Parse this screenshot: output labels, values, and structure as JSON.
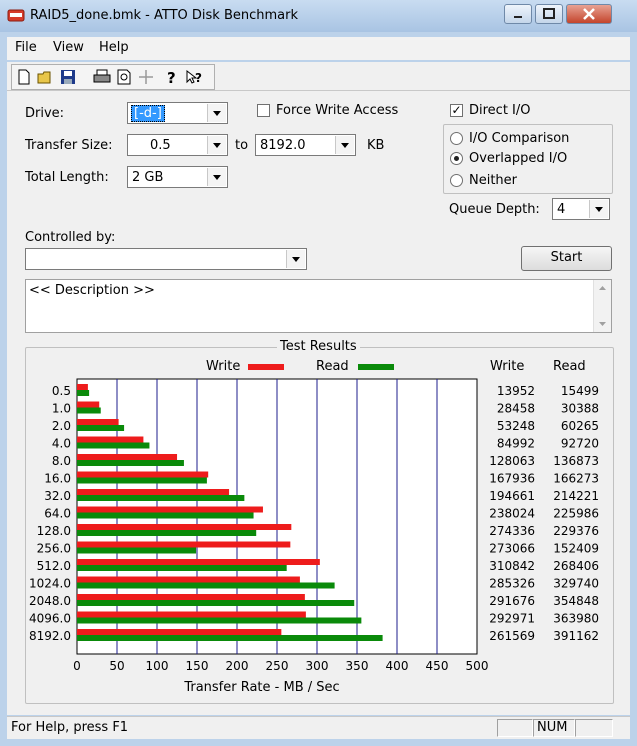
{
  "window": {
    "title": "RAID5_done.bmk - ATTO Disk Benchmark"
  },
  "menu": {
    "file": "File",
    "view": "View",
    "help": "Help"
  },
  "toolbar": {
    "icons": [
      "new-icon",
      "open-icon",
      "save-icon",
      "print-icon",
      "print-preview-icon",
      "move-icon",
      "help-icon",
      "context-help-icon"
    ]
  },
  "form": {
    "drive_label": "Drive:",
    "drive_value": "[-d-]",
    "force_write_label": "Force Write Access",
    "force_write_checked": false,
    "direct_io_label": "Direct I/O",
    "direct_io_checked": true,
    "transfer_size_label": "Transfer Size:",
    "transfer_from": "0.5",
    "to_label": "to",
    "transfer_to": "8192.0",
    "kb_label": "KB",
    "total_length_label": "Total Length:",
    "total_length_value": "2 GB",
    "io_comparison_label": "I/O Comparison",
    "overlapped_io_label": "Overlapped I/O",
    "neither_label": "Neither",
    "selected_mode": "Overlapped I/O",
    "queue_depth_label": "Queue Depth:",
    "queue_depth_value": "4",
    "controlled_by_label": "Controlled by:",
    "controlled_by_value": "",
    "start_label": "Start",
    "description_text": "<< Description >>"
  },
  "results": {
    "group_title": "Test Results",
    "legend_write": "Write",
    "legend_read": "Read",
    "col_write": "Write",
    "col_read": "Read",
    "write_color": "#ee1c1c",
    "read_color": "#0a8a0a"
  },
  "chart_data": {
    "type": "bar",
    "orientation": "horizontal",
    "categories": [
      "0.5",
      "1.0",
      "2.0",
      "4.0",
      "8.0",
      "16.0",
      "32.0",
      "64.0",
      "128.0",
      "256.0",
      "512.0",
      "1024.0",
      "2048.0",
      "4096.0",
      "8192.0"
    ],
    "series": [
      {
        "name": "Write",
        "values": [
          13952,
          28458,
          53248,
          84992,
          128063,
          167936,
          194661,
          238024,
          274336,
          273066,
          310842,
          285326,
          291676,
          292971,
          261569
        ]
      },
      {
        "name": "Read",
        "values": [
          15499,
          30388,
          60265,
          92720,
          136873,
          166273,
          214221,
          225986,
          229376,
          152409,
          268406,
          329740,
          354848,
          363980,
          391162
        ]
      }
    ],
    "write_table": [
      "13952",
      "28458",
      "53248",
      "84992",
      "128063",
      "167936",
      "194661",
      "238024",
      "274336",
      "273066",
      "310842",
      "285326",
      "291676",
      "292971",
      "261569"
    ],
    "read_table": [
      "15499",
      "30388",
      "60265",
      "92720",
      "136873",
      "166273",
      "214221",
      "225986",
      "229376",
      "152409",
      "268406",
      "329740",
      "354848",
      "363980",
      "391162"
    ],
    "xticks": [
      "0",
      "50",
      "100",
      "150",
      "200",
      "250",
      "300",
      "350",
      "400",
      "450",
      "500"
    ],
    "xlim": [
      0,
      500
    ],
    "xlabel": "Transfer Rate - MB / Sec",
    "grid": true
  },
  "status": {
    "help_text": "For Help, press F1",
    "num": "NUM"
  }
}
